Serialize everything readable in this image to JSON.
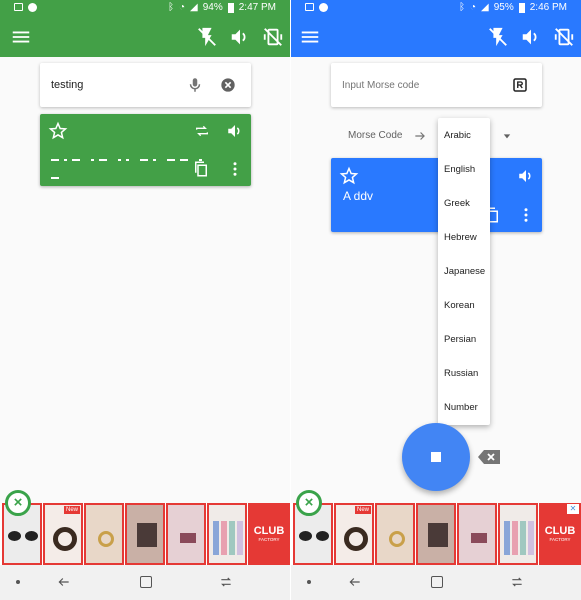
{
  "left": {
    "status": {
      "icons_left": [
        "image-icon",
        "notification-icon"
      ],
      "battery": "94%",
      "time": "2:47 PM"
    },
    "appbar_color": "#43a047",
    "input_value": "testing",
    "output_text": "",
    "ad_badge": "New",
    "ad_brand": "CLUB",
    "ad_brand_sub": "FACTORY"
  },
  "right": {
    "status": {
      "battery": "95%",
      "time": "2:46 PM"
    },
    "appbar_color": "#2979ff",
    "input_placeholder": "Input Morse code",
    "source_language": "Morse Code",
    "output_text": "A ddv",
    "menu_items": [
      "Arabic",
      "English",
      "Greek",
      "Hebrew",
      "Japanese",
      "Korean",
      "Persian",
      "Russian",
      "Number"
    ],
    "ad_badge": "New",
    "ad_brand": "CLUB",
    "ad_brand_sub": "FACTORY"
  },
  "colors": {
    "green": "#43a047",
    "blue": "#2979ff",
    "ad_border": "#e53935",
    "fab": "#4285f4"
  }
}
